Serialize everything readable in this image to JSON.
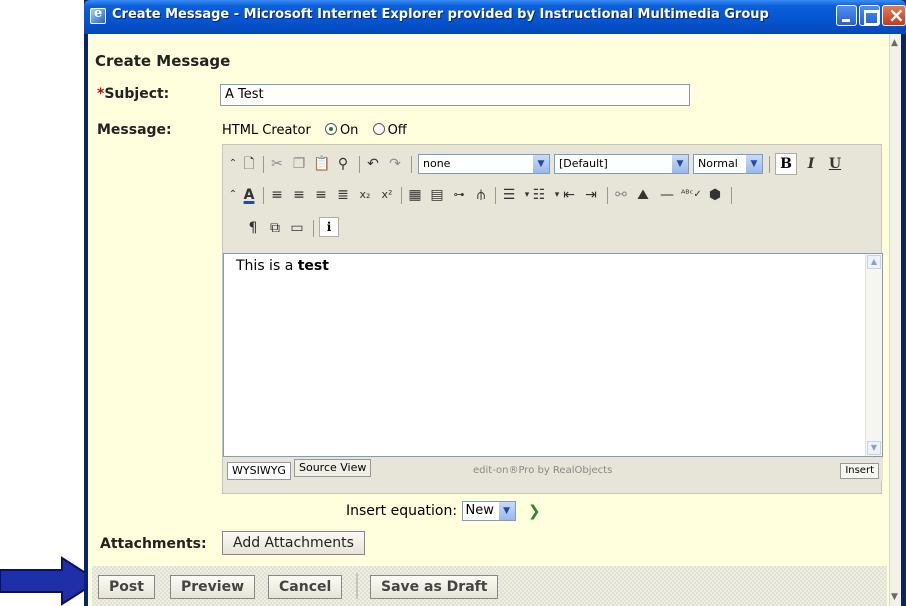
{
  "window": {
    "title": "Create Message - Microsoft Internet Explorer provided by Instructional Multimedia Group"
  },
  "page": {
    "heading": "Create Message",
    "subject_label": "Subject:",
    "subject_required_mark": "*",
    "subject_value": "A Test",
    "message_label": "Message:",
    "html_creator_label": "HTML Creator",
    "html_creator_on": "On",
    "html_creator_off": "Off",
    "html_creator_selected": "On"
  },
  "editor": {
    "style_select": "none",
    "font_select": "[Default]",
    "size_select": "Normal",
    "bold_label": "B",
    "italic_label": "I",
    "underline_label": "U",
    "content_plain": "This is a ",
    "content_bold": "test",
    "tab_wysiwyg": "WYSIWYG",
    "tab_source": "Source View",
    "credit": "edit-on®Pro by RealObjects",
    "insert_label": "Insert"
  },
  "equation": {
    "label": "Insert equation:",
    "selected": "New"
  },
  "attachments": {
    "label": "Attachments:",
    "button": "Add Attachments"
  },
  "actions": {
    "post": "Post",
    "preview": "Preview",
    "cancel": "Cancel",
    "save_draft": "Save as Draft"
  },
  "colors": {
    "page_background": "#ffffdd",
    "titlebar": "#0554d0",
    "pointer_arrow": "#1f2fa8"
  }
}
